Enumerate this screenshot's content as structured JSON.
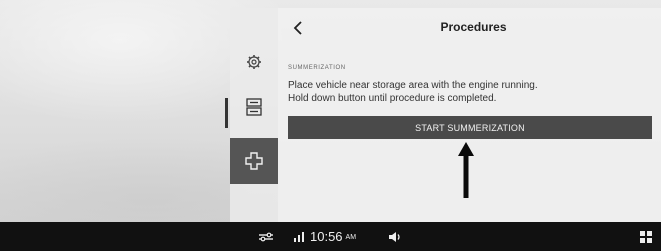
{
  "panel": {
    "title": "Procedures",
    "section_label": "SUMMERIZATION",
    "instruction_line1": "Place vehicle near storage area with the engine running.",
    "instruction_line2": "Hold down button until procedure is completed.",
    "start_button_label": "START SUMMERIZATION"
  },
  "sidebar": {
    "items": [
      {
        "icon": "gear-icon"
      },
      {
        "icon": "panels-icon"
      },
      {
        "icon": "service-cross-icon",
        "active": true
      }
    ]
  },
  "status_bar": {
    "time": "10:56",
    "ampm": "AM",
    "icons": [
      "toggle-icon",
      "signal-icon",
      "volume-icon",
      "app-grid-icon"
    ]
  }
}
